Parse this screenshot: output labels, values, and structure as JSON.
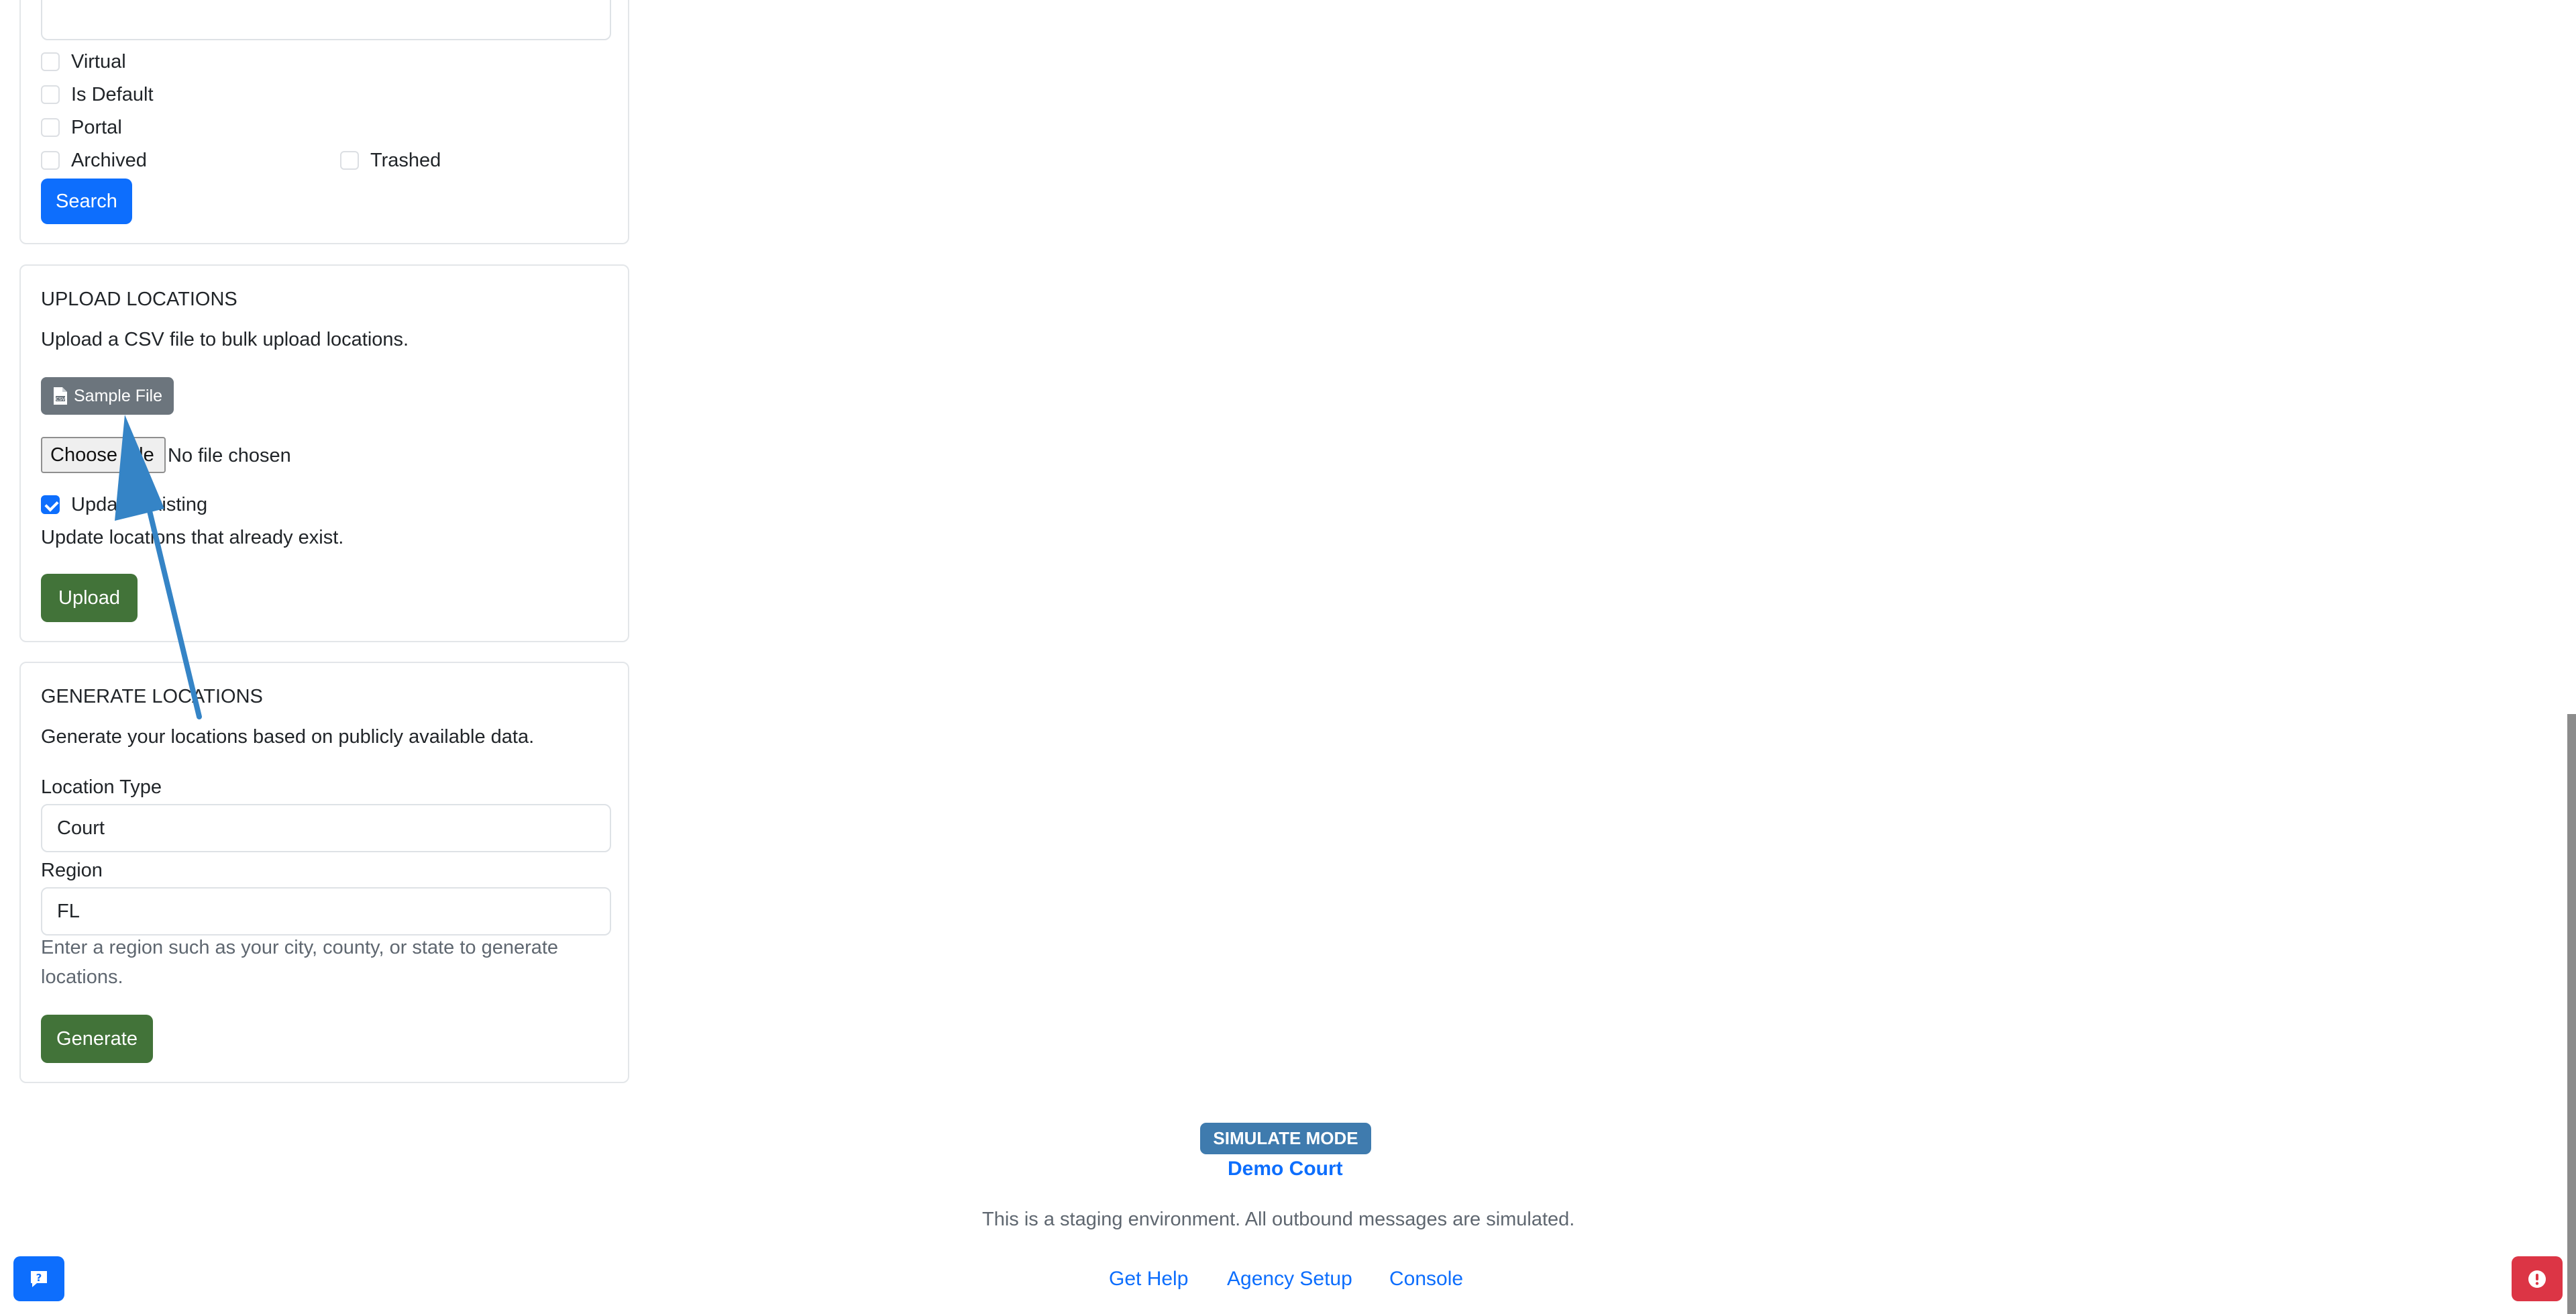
{
  "search_filters": {
    "checkboxes": {
      "virtual": {
        "label": "Virtual",
        "checked": false
      },
      "is_default": {
        "label": "Is Default",
        "checked": false
      },
      "portal": {
        "label": "Portal",
        "checked": false
      },
      "archived": {
        "label": "Archived",
        "checked": false
      },
      "trashed": {
        "label": "Trashed",
        "checked": false
      }
    },
    "search_button": "Search"
  },
  "upload": {
    "title": "UPLOAD LOCATIONS",
    "description": "Upload a CSV file to bulk upload locations.",
    "sample_button": "Sample File",
    "file_button": "Choose File",
    "file_status": "No file chosen",
    "update_existing": {
      "label": "Update Existing",
      "checked": true
    },
    "help": "Update locations that already exist.",
    "upload_button": "Upload"
  },
  "generate": {
    "title": "GENERATE LOCATIONS",
    "description": "Generate your locations based on publicly available data.",
    "location_type_label": "Location Type",
    "location_type_value": "Court",
    "region_label": "Region",
    "region_value": "FL",
    "region_help_line1": "Enter a region such as your city, county, or state to generate",
    "region_help_line2": "locations.",
    "generate_button": "Generate"
  },
  "footer": {
    "mode_badge": "SIMULATE MODE",
    "agency_name": "Demo Court",
    "staging_notice": "This is a staging environment. All outbound messages are simulated.",
    "links": {
      "help": "Get Help",
      "setup": "Agency Setup",
      "console": "Console"
    }
  },
  "colors": {
    "primary": "#0d6efd",
    "success": "#427339",
    "secondary": "#6c757d",
    "badge": "#3f7bae",
    "danger": "#dc3545",
    "annotation_arrow": "#3584c6"
  },
  "icons": {
    "sample_file": "file-csv-icon",
    "help_widget": "question-chat-icon",
    "error_widget": "exclamation-circle-icon"
  }
}
